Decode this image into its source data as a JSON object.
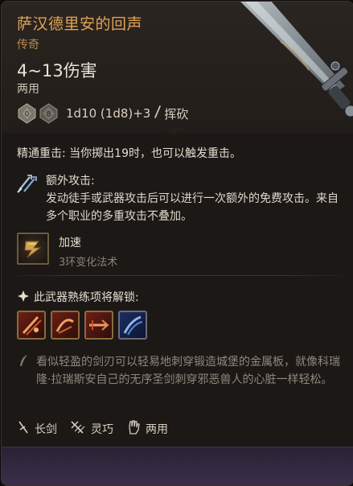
{
  "item": {
    "name": "萨汉德里安的回声",
    "rarity": "传奇",
    "damage": "4~13伤害",
    "handedness": "两用",
    "dice_text": "1d10 (1d8)+3",
    "damage_type": "挥砍"
  },
  "effects": {
    "critical": "精通重击: 当你掷出19时，也可以触发重击。",
    "extra_attack_title": "额外攻击:",
    "extra_attack_desc": "发动徒手或武器攻击后可以进行一次额外的免费攻击。来自多个职业的多重攻击不叠加。"
  },
  "spell": {
    "name": "加速",
    "subtitle": "3环变化法术"
  },
  "proficiency": {
    "title": "此武器熟练项将解锁:"
  },
  "lore": "看似轻盈的剑刃可以轻易地刺穿锻造城堡的金属板，就像科瑞隆·拉瑞斯安自己的无序圣剑刺穿邪恶兽人的心脏一样轻松。",
  "tags": [
    {
      "icon": "longsword-icon",
      "label": "长剑"
    },
    {
      "icon": "finesse-icon",
      "label": "灵巧"
    },
    {
      "icon": "versatile-hand-icon",
      "label": "两用"
    }
  ],
  "colors": {
    "name": "#e0a454",
    "rarity": "#b68a4c",
    "footer": "#3a2f4a"
  }
}
